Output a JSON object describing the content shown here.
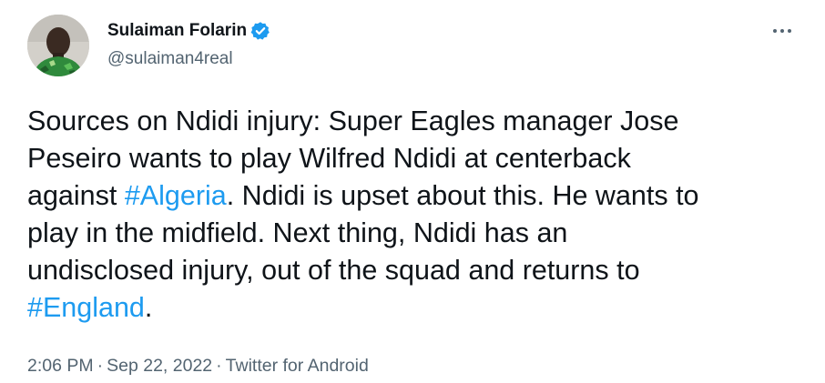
{
  "author": {
    "display_name": "Sulaiman Folarin",
    "handle": "@sulaiman4real",
    "verified": true
  },
  "tweet": {
    "lines": [
      [
        "Sources on Ndidi injury: Super Eagles manager Jose"
      ],
      [
        "Peseiro wants to play Wilfred Ndidi at centerback"
      ],
      [
        "against ",
        "#Algeria",
        ". Ndidi is upset about this. He wants to"
      ],
      [
        "play in the midfield. Next thing, Ndidi has an"
      ],
      [
        "undisclosed injury, out of the squad and returns to"
      ],
      [
        "#England",
        "."
      ]
    ],
    "line1": "Sources on Ndidi injury: Super Eagles manager Jose",
    "line2": "Peseiro wants to play Wilfred Ndidi at centerback",
    "line3_pre": "against ",
    "hashtag1": "#Algeria",
    "line3_post": ". Ndidi is upset about this. He wants to",
    "line4": "play in the midfield. Next thing, Ndidi has an",
    "line5": "undisclosed injury, out of the squad and returns to",
    "hashtag2": "#England",
    "line6_post": "."
  },
  "meta": {
    "time": "2:06 PM",
    "separator": "·",
    "date": "Sep 22, 2022",
    "source": "Twitter for Android"
  },
  "colors": {
    "text": "#0f1419",
    "secondary": "#536471",
    "accent": "#1d9bf0"
  },
  "icons": {
    "verified": "verified-badge-icon",
    "more": "more-horizontal-icon"
  }
}
